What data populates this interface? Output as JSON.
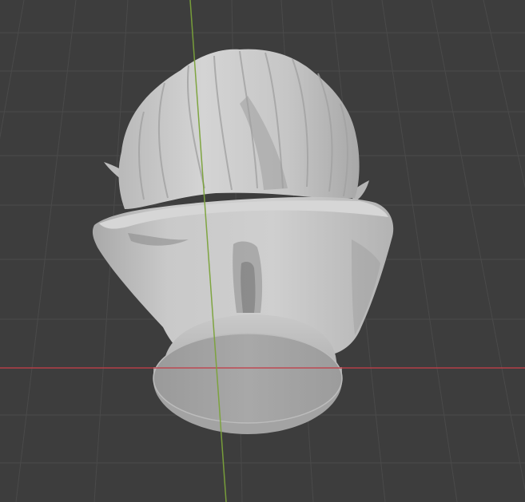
{
  "viewport": {
    "view": "3d-viewport",
    "shading": "solid",
    "object": "bust-sculpture",
    "colors": {
      "background": "#3d3d3d",
      "grid_line": "#4b4b4b",
      "x_axis": "#c0404a",
      "y_axis": "#7ba33a",
      "mesh_light": "#cfcfcf",
      "mesh_mid": "#b4b4b4",
      "mesh_shadow": "#8f8f8f"
    }
  }
}
